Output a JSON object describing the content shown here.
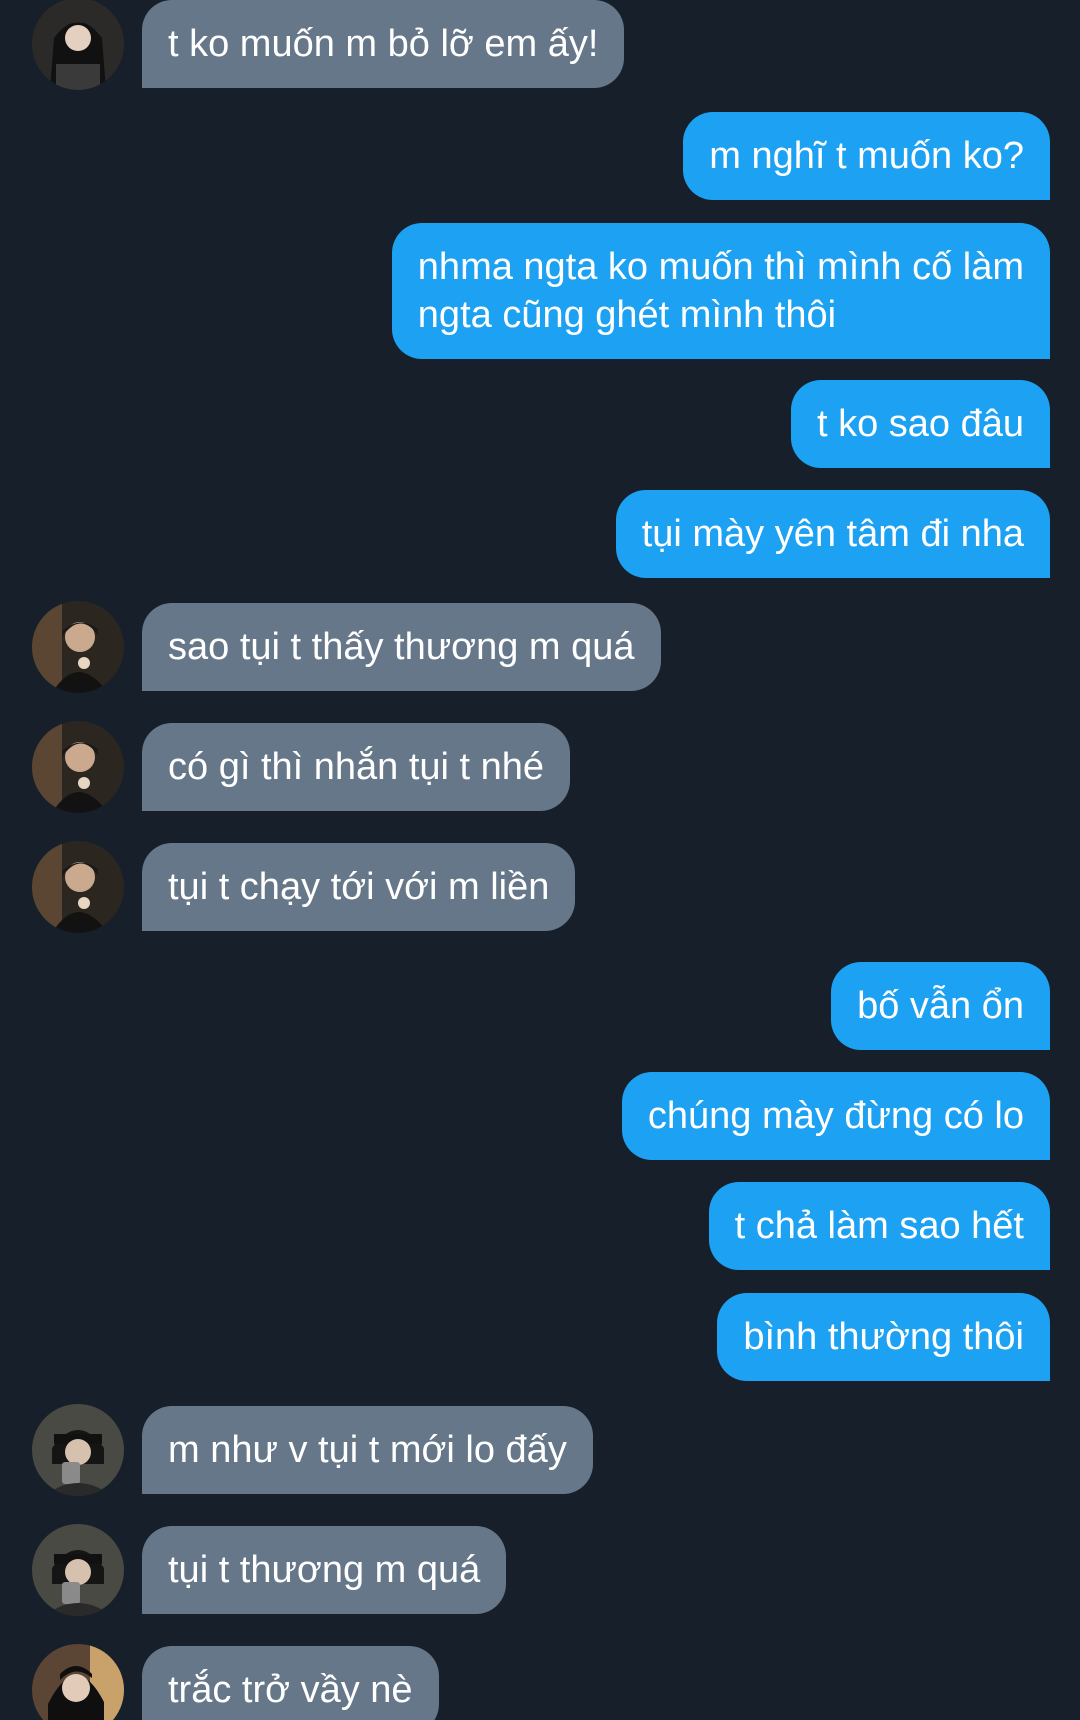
{
  "conversation": {
    "messages": [
      {
        "side": "in",
        "avatar": "avatar-a",
        "text": "t ko muốn m bỏ lỡ em ấy!"
      },
      {
        "side": "out",
        "text": "m nghĩ t muốn ko?"
      },
      {
        "side": "out",
        "text": "nhma ngta ko muốn thì mình cố làm\nngta cũng ghét mình thôi"
      },
      {
        "side": "out",
        "text": "t ko sao đâu"
      },
      {
        "side": "out",
        "text": "tụi mày yên tâm đi nha"
      },
      {
        "side": "in",
        "avatar": "avatar-b",
        "text": "sao tụi t thấy thương m quá"
      },
      {
        "side": "in",
        "avatar": "avatar-b",
        "text": "có gì thì nhắn tụi t nhé"
      },
      {
        "side": "in",
        "avatar": "avatar-b",
        "text": "tụi t chạy tới với m liền"
      },
      {
        "side": "out",
        "text": "bố vẫn ổn"
      },
      {
        "side": "out",
        "text": "chúng mày đừng có lo"
      },
      {
        "side": "out",
        "text": "t chả làm sao hết"
      },
      {
        "side": "out",
        "text": "bình thường thôi"
      },
      {
        "side": "in",
        "avatar": "avatar-c",
        "text": "m như v tụi t mới lo đấy"
      },
      {
        "side": "in",
        "avatar": "avatar-c",
        "text": "tụi t thương m quá"
      },
      {
        "side": "in",
        "avatar": "avatar-d",
        "text": "trắc trở vầy nè"
      }
    ]
  },
  "colors": {
    "background": "#17202a",
    "incoming_bubble": "#66778a",
    "outgoing_bubble": "#1da1f2",
    "text": "#ffffff"
  }
}
